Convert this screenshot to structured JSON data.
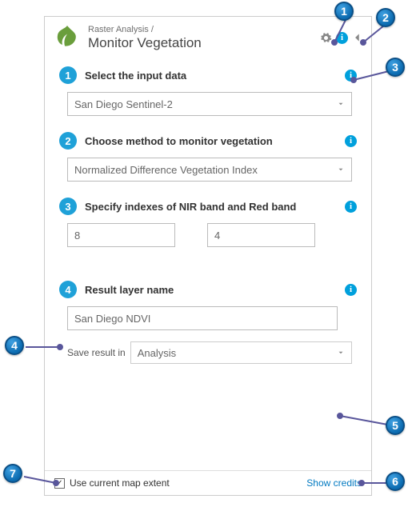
{
  "header": {
    "breadcrumb": "Raster Analysis /",
    "title": "Monitor Vegetation"
  },
  "sections": {
    "s1": {
      "num": "1",
      "label": "Select the input data",
      "value": "San Diego Sentinel-2"
    },
    "s2": {
      "num": "2",
      "label": "Choose method to monitor vegetation",
      "value": "Normalized Difference Vegetation Index"
    },
    "s3": {
      "num": "3",
      "label": "Specify indexes of NIR band and Red band",
      "nir": "8",
      "red": "4"
    },
    "s4": {
      "num": "4",
      "label": "Result layer name",
      "value": "San Diego NDVI",
      "save_label": "Save result in",
      "save_value": "Analysis"
    }
  },
  "footer": {
    "extent_label": "Use current map extent",
    "extent_checked": "✓",
    "credits": "Show credits"
  },
  "info_glyph": "i",
  "callouts": {
    "c1": "1",
    "c2": "2",
    "c3": "3",
    "c4": "4",
    "c5": "5",
    "c6": "6",
    "c7": "7"
  }
}
